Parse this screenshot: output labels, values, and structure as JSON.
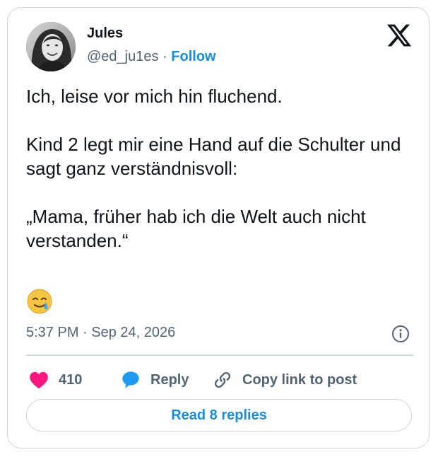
{
  "author": {
    "name": "Jules",
    "handle": "@ed_ju1es",
    "separator": "·",
    "follow_label": "Follow"
  },
  "tweet": {
    "paragraphs": [
      "Ich, leise vor mich hin fluchend.",
      "Kind 2 legt mir eine Hand auf die Schulter und sagt ganz verständnisvoll:",
      "„Mama, früher hab ich die Welt auch nicht verstanden.“"
    ],
    "emoji": "🥲",
    "timestamp": "5:37 PM · Sep 24, 2026"
  },
  "actions": {
    "like_count": "410",
    "reply_label": "Reply",
    "copy_link_label": "Copy link to post"
  },
  "read_replies_label": "Read 8 replies",
  "colors": {
    "accent_blue": "#1a8cd8",
    "like_pink": "#f91880",
    "secondary_text": "#536471",
    "border": "#cfd9de"
  },
  "icons": [
    "x-logo-icon",
    "heart-icon",
    "reply-bubble-icon",
    "link-icon",
    "info-icon",
    "smiling-face-with-tear-emoji"
  ]
}
